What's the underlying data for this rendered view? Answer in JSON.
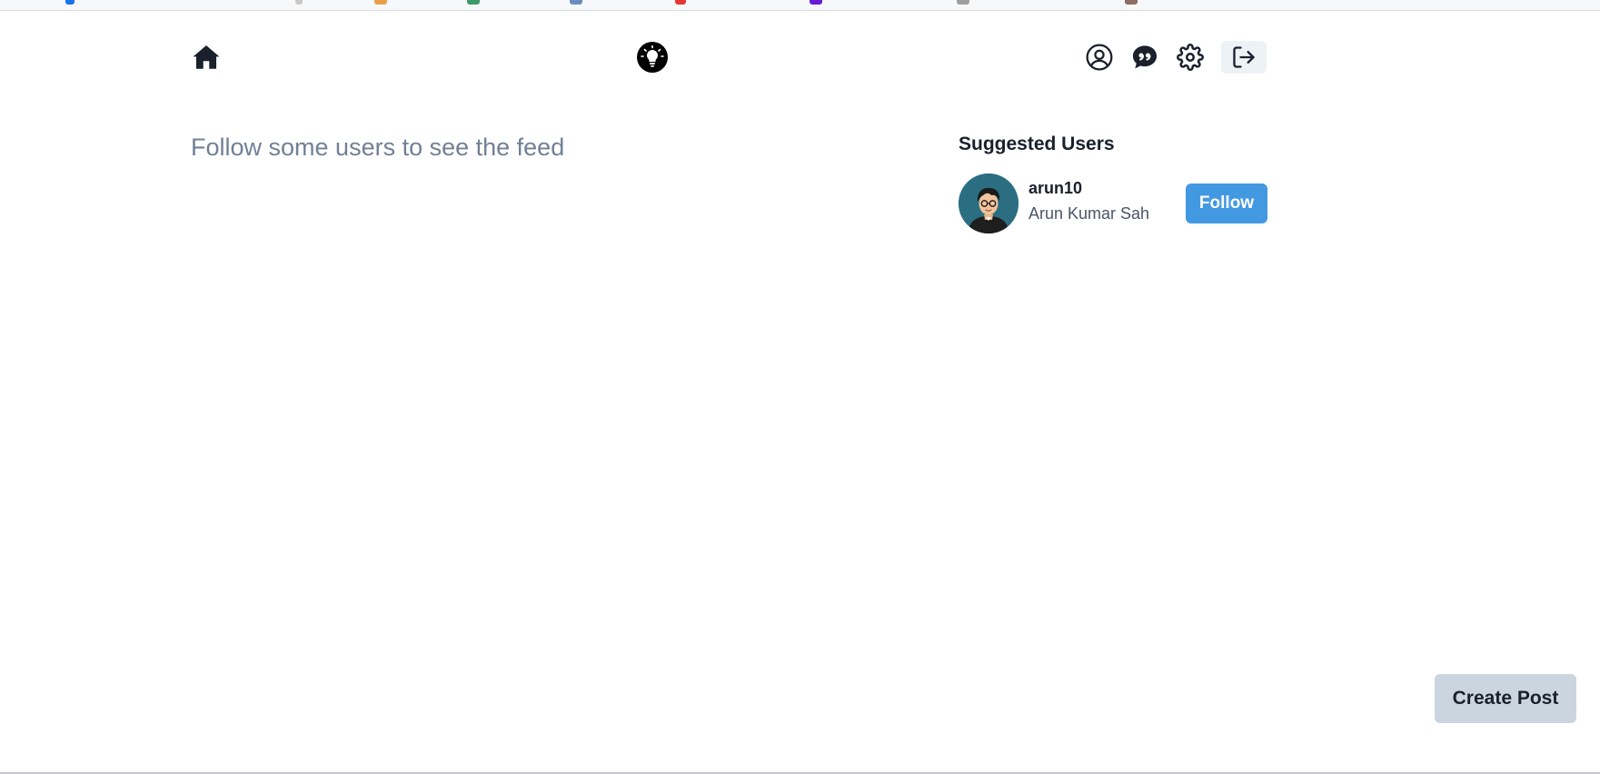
{
  "nav": {
    "home_icon": "home-icon",
    "logo_icon": "lightbulb-icon",
    "profile_icon": "user-circle-icon",
    "chat_icon": "chat-quote-icon",
    "settings_icon": "gear-icon",
    "logout_icon": "logout-icon"
  },
  "feed": {
    "empty_message": "Follow some users to see the feed"
  },
  "suggested": {
    "title": "Suggested Users",
    "users": [
      {
        "username": "arun10",
        "full_name": "Arun Kumar Sah",
        "follow_label": "Follow"
      }
    ]
  },
  "actions": {
    "create_post_label": "Create Post"
  },
  "colors": {
    "accent": "#4299e1",
    "muted_text": "#718096",
    "create_post_bg": "#cbd5e0",
    "logout_bg": "#edf2f7"
  }
}
